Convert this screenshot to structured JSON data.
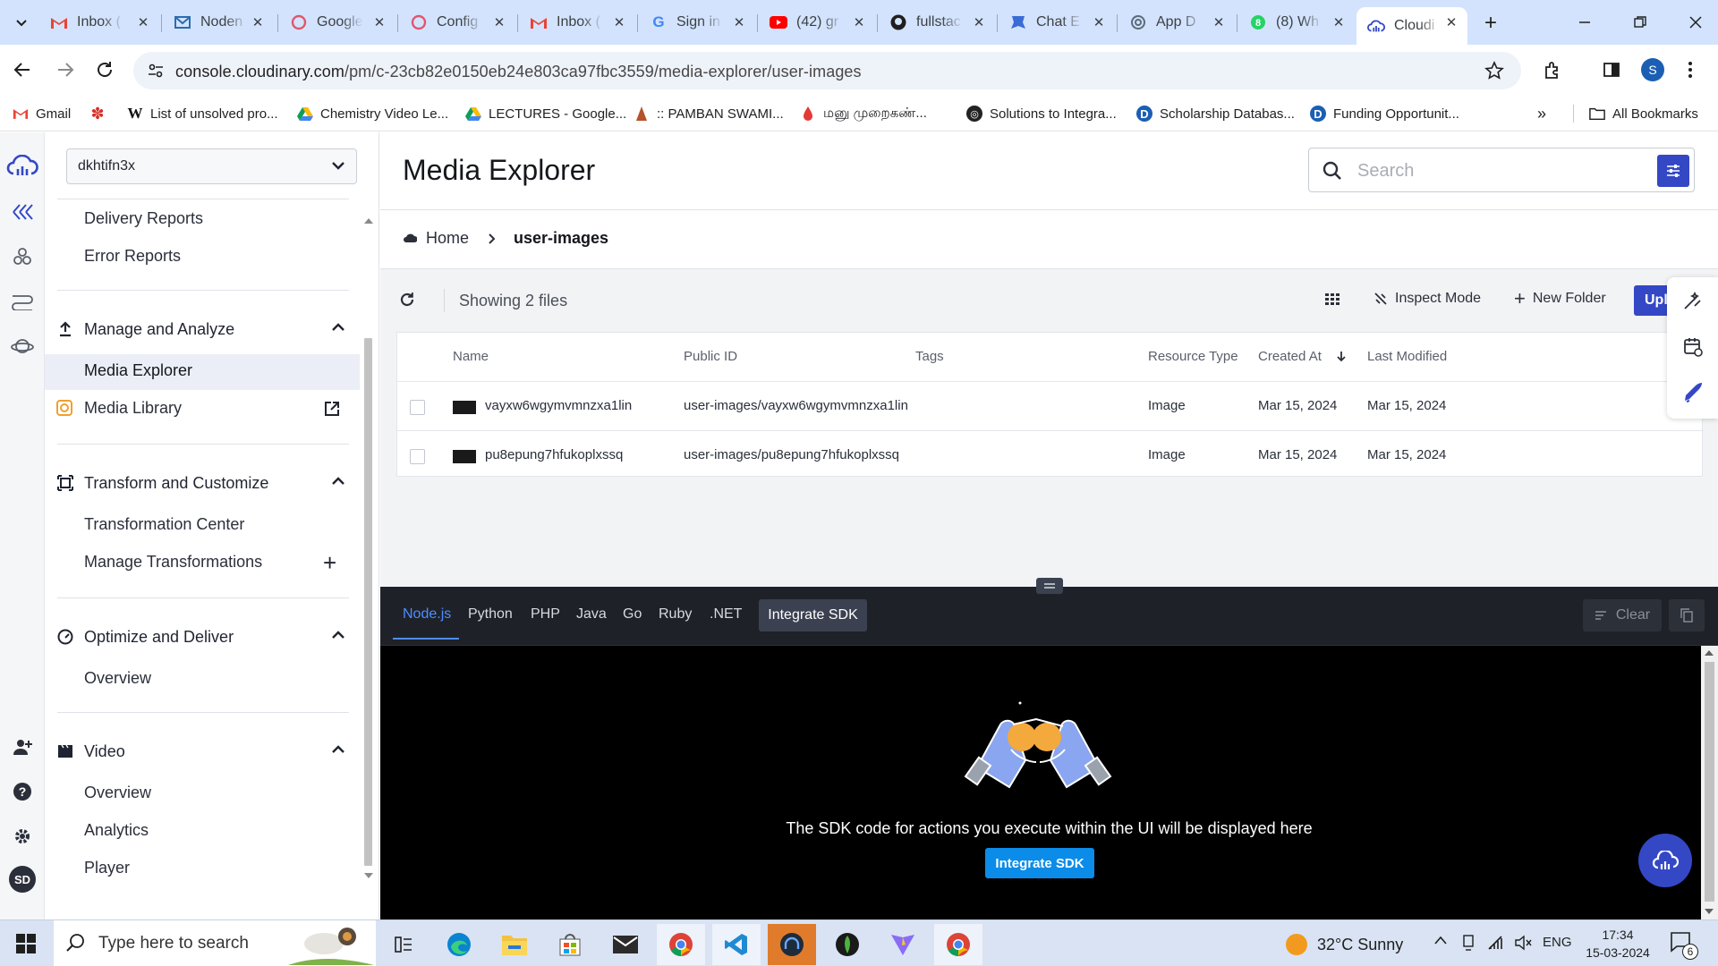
{
  "browser": {
    "tabs": [
      {
        "title": "Inbox (",
        "icon": "gmail-icon"
      },
      {
        "title": "Noden",
        "icon": "nodemailer-icon"
      },
      {
        "title": "Google",
        "icon": "account-icon"
      },
      {
        "title": "Config",
        "icon": "account-icon"
      },
      {
        "title": "Inbox (",
        "icon": "gmail-icon"
      },
      {
        "title": "Sign in",
        "icon": "google-icon"
      },
      {
        "title": "(42) gr",
        "icon": "youtube-icon"
      },
      {
        "title": "fullstac",
        "icon": "github-icon"
      },
      {
        "title": "Chat E",
        "icon": "chat-icon"
      },
      {
        "title": "App D",
        "icon": "openai-icon"
      },
      {
        "title": "(8) Wh",
        "icon": "whatsapp-icon"
      },
      {
        "title": "Cloudi",
        "icon": "cloudinary-icon"
      }
    ],
    "url_host": "console.cloudinary.com",
    "url_path": "/pm/c-23cb82e0150eb24e803ca97fbc3559/media-explorer/user-images",
    "profile_initial": "S",
    "bookmarks": [
      {
        "label": "Gmail",
        "icon": "gmail-icon"
      },
      {
        "label": "",
        "icon": "flower-icon"
      },
      {
        "label": "List of unsolved pro...",
        "icon": "wikipedia-icon"
      },
      {
        "label": "Chemistry Video Le...",
        "icon": "drive-icon"
      },
      {
        "label": "LECTURES - Google...",
        "icon": "drive-icon"
      },
      {
        "label": ":: PAMBAN SWAMI...",
        "icon": "temple-icon"
      },
      {
        "label": "மனு முறைகண்...",
        "icon": "drop-icon"
      },
      {
        "label": "Solutions to Integra...",
        "icon": "globe-icon"
      },
      {
        "label": "Scholarship Databas...",
        "icon": "d-icon"
      },
      {
        "label": "Funding Opportunit...",
        "icon": "d-icon"
      }
    ],
    "all_bookmarks": "All Bookmarks"
  },
  "sidebar": {
    "cloud_name": "dkhtifn3x",
    "items_top": [
      "Delivery Reports",
      "Error Reports"
    ],
    "sections": [
      {
        "title": "Manage and Analyze",
        "items": [
          "Media Explorer",
          "Media Library"
        ]
      },
      {
        "title": "Transform and Customize",
        "items": [
          "Transformation Center",
          "Manage Transformations"
        ]
      },
      {
        "title": "Optimize and Deliver",
        "items": [
          "Overview"
        ]
      },
      {
        "title": "Video",
        "items": [
          "Overview",
          "Analytics",
          "Player"
        ]
      }
    ],
    "avatar_initials": "SD"
  },
  "main": {
    "title": "Media Explorer",
    "search_placeholder": "Search",
    "breadcrumb": {
      "home": "Home",
      "current": "user-images"
    },
    "showing": "Showing 2 files",
    "inspect_mode": "Inspect Mode",
    "new_folder": "New Folder",
    "upload": "Upload",
    "columns": [
      "Name",
      "Public ID",
      "Tags",
      "Resource Type",
      "Created At",
      "Last Modified"
    ],
    "rows": [
      {
        "name": "vayxw6wgymvmnzxa1lin",
        "public_id": "user-images/vayxw6wgymvmnzxa1lin",
        "tags": "",
        "resource_type": "Image",
        "created_at": "Mar 15, 2024",
        "last_modified": "Mar 15, 2024"
      },
      {
        "name": "pu8epung7hfukoplxssq",
        "public_id": "user-images/pu8epung7hfukoplxssq",
        "tags": "",
        "resource_type": "Image",
        "created_at": "Mar 15, 2024",
        "last_modified": "Mar 15, 2024"
      }
    ]
  },
  "sdk": {
    "tabs": [
      "Node.js",
      "Python",
      "PHP",
      "Java",
      "Go",
      "Ruby",
      ".NET"
    ],
    "integrate_label": "Integrate SDK",
    "clear_label": "Clear",
    "message": "The SDK code for actions you execute within the UI will be displayed here",
    "cta_label": "Integrate SDK"
  },
  "taskbar": {
    "search_placeholder": "Type here to search",
    "weather": "32°C  Sunny",
    "lang": "ENG",
    "time": "17:34",
    "date": "15-03-2024",
    "notifications": "6"
  },
  "colors": {
    "accent": "#3448c5",
    "cta": "#0b8ce9",
    "tabstrip": "#d3e3fd"
  }
}
